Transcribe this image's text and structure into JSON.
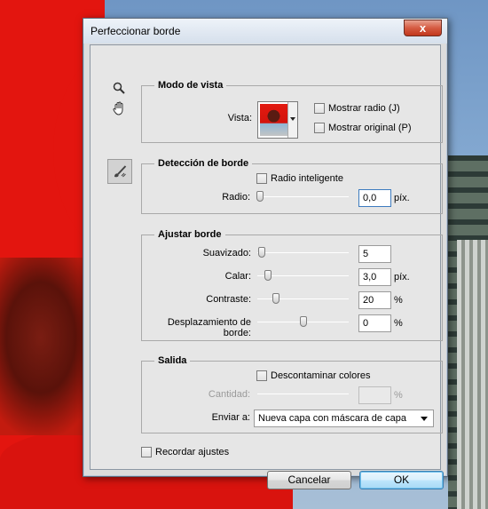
{
  "dialog": {
    "title": "Perfeccionar borde",
    "close_glyph": "x"
  },
  "tools": [
    {
      "name": "zoom-tool",
      "icon": "magnifier-icon"
    },
    {
      "name": "hand-tool",
      "icon": "hand-icon"
    },
    {
      "name": "refine-radius-tool",
      "icon": "brush-icon"
    }
  ],
  "view_mode": {
    "group_title": "Modo de vista",
    "view_label": "Vista:",
    "show_radius": {
      "label": "Mostrar radio (J)",
      "checked": false
    },
    "show_original": {
      "label": "Mostrar original (P)",
      "checked": false
    }
  },
  "edge_detection": {
    "group_title": "Detección de borde",
    "smart_radius": {
      "label": "Radio inteligente",
      "checked": false
    },
    "radius_label": "Radio:",
    "radius_value": "0,0",
    "radius_unit": "píx.",
    "radius_slider_fraction": 0.0
  },
  "adjust_edge": {
    "group_title": "Ajustar borde",
    "rows": [
      {
        "label": "Suavizado:",
        "value": "5",
        "unit": "",
        "slider_fraction": 0.05
      },
      {
        "label": "Calar:",
        "value": "3,0",
        "unit": "píx.",
        "slider_fraction": 0.12
      },
      {
        "label": "Contraste:",
        "value": "20",
        "unit": "%",
        "slider_fraction": 0.2
      },
      {
        "label": "Desplazamiento de borde:",
        "value": "0",
        "unit": "%",
        "slider_fraction": 0.5
      }
    ]
  },
  "output": {
    "group_title": "Salida",
    "decontaminate": {
      "label": "Descontaminar colores",
      "checked": false
    },
    "amount_label": "Cantidad:",
    "amount_value": "",
    "amount_unit": "%",
    "output_to_label": "Enviar a:",
    "output_to_value": "Nueva capa con máscara de capa"
  },
  "remember": {
    "label": "Recordar ajustes",
    "checked": false
  },
  "buttons": {
    "cancel": "Cancelar",
    "ok": "OK"
  },
  "colors": {
    "background_red": "#e3150f",
    "default_button": "#a7d9f5"
  }
}
